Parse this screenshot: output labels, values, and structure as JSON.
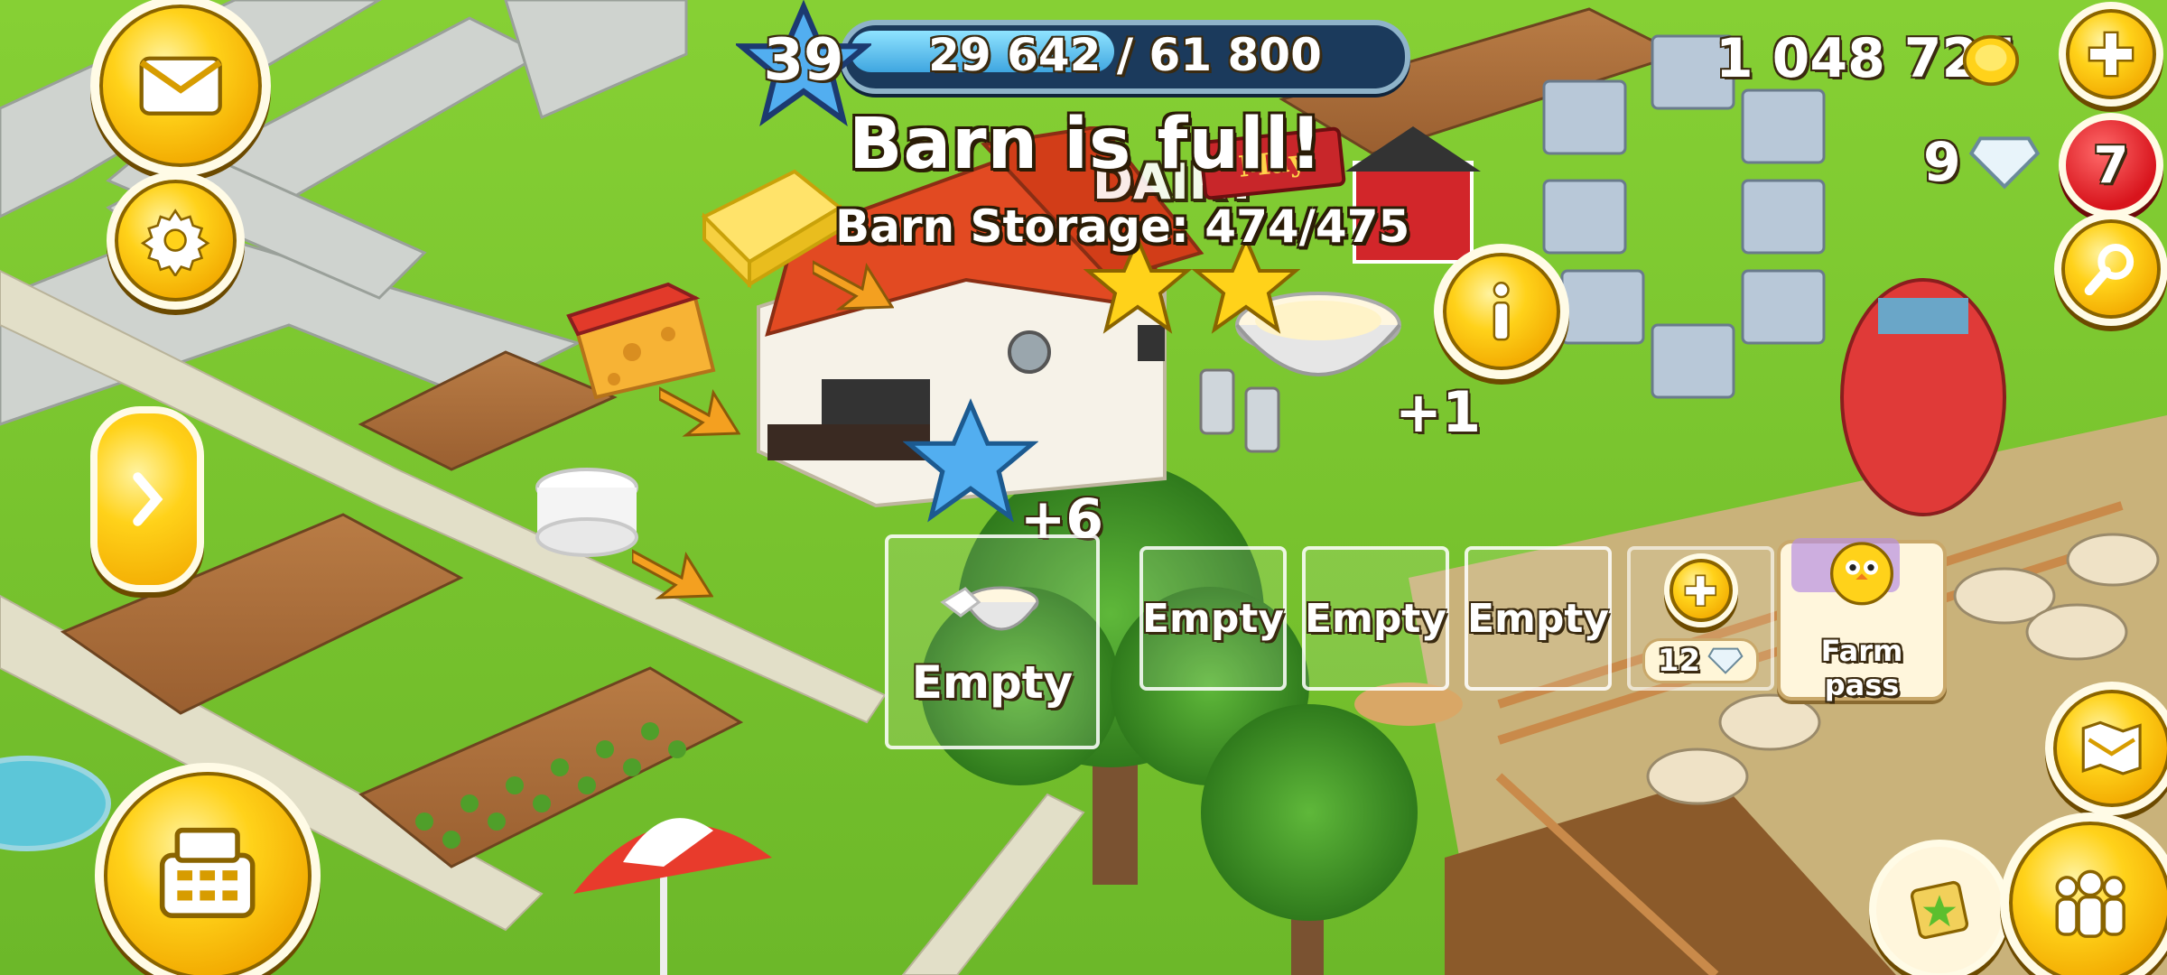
{
  "hud": {
    "level": "39",
    "xp_text": "29 642 / 61 800",
    "xp_progress": 0.48,
    "coins": "1 048 725",
    "diamonds": "9",
    "notification_count": "7"
  },
  "popup": {
    "title": "Barn is full!",
    "storage_text": "Barn Storage: 474/475",
    "building_sign": "DAIRY",
    "sign_small": "May"
  },
  "production": {
    "bonus_xp": "+6",
    "bonus_item": "+1",
    "active_slot_label": "Empty",
    "queue_slots": [
      "Empty",
      "Empty",
      "Empty"
    ],
    "unlock_cost": "12",
    "farm_pass_label": "Farm pass"
  },
  "colors": {
    "grass": "#7cc62e",
    "gold_button": "#ffd21a",
    "alert_red": "#d8141c"
  },
  "icons": {
    "mail": "mail-icon",
    "settings": "gear-icon",
    "expand": "chevron-right-icon",
    "shop": "cash-register-icon",
    "add": "plus-icon",
    "search": "magnifier-icon",
    "info": "info-icon",
    "map": "map-icon",
    "friends": "friends-icon"
  }
}
